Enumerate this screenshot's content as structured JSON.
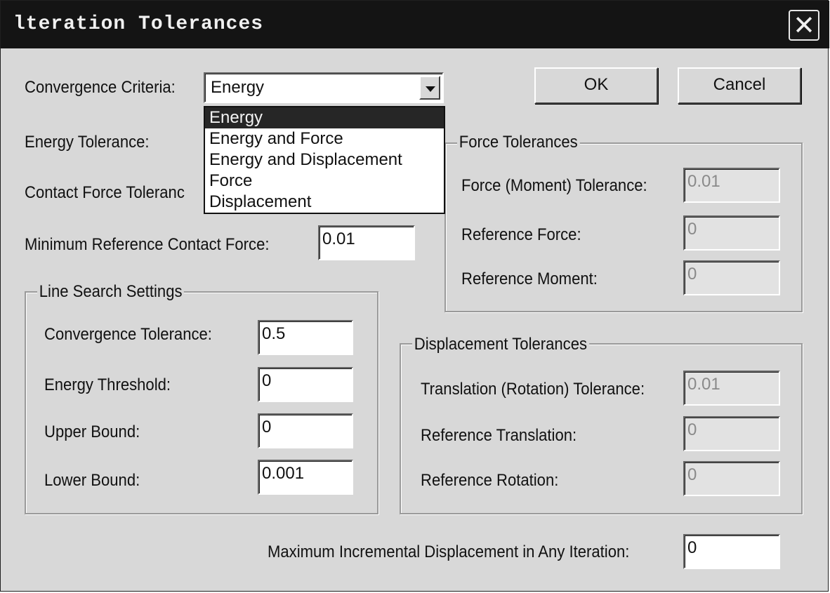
{
  "window": {
    "title": "lteration Tolerances",
    "close_label": "✕"
  },
  "buttons": {
    "ok": "OK",
    "cancel": "Cancel"
  },
  "convergence": {
    "label": "Convergence Criteria:",
    "value": "Energy",
    "options": [
      "Energy",
      "Energy and Force",
      "Energy and Displacement",
      "Force",
      "Displacement"
    ],
    "selected_index": 0
  },
  "energy_tolerance": {
    "label": "Energy Tolerance:"
  },
  "contact_force_tolerance": {
    "label": "Contact Force Toleranc"
  },
  "min_ref_contact_force": {
    "label": "Minimum Reference Contact Force:",
    "value": "0.01"
  },
  "line_search": {
    "title": "Line Search Settings",
    "convergence_tolerance": {
      "label": "Convergence Tolerance:",
      "value": "0.5"
    },
    "energy_threshold": {
      "label": "Energy Threshold:",
      "value": "0"
    },
    "upper_bound": {
      "label": "Upper Bound:",
      "value": "0"
    },
    "lower_bound": {
      "label": "Lower Bound:",
      "value": "0.001"
    }
  },
  "force_tolerances": {
    "title": "Force Tolerances",
    "force_moment_tolerance": {
      "label": "Force (Moment) Tolerance:",
      "value": "0.01"
    },
    "reference_force": {
      "label": "Reference Force:",
      "value": "0"
    },
    "reference_moment": {
      "label": "Reference Moment:",
      "value": "0"
    }
  },
  "displacement_tolerances": {
    "title": "Displacement Tolerances",
    "translation_rotation_tolerance": {
      "label": "Translation (Rotation) Tolerance:",
      "value": "0.01"
    },
    "reference_translation": {
      "label": "Reference Translation:",
      "value": "0"
    },
    "reference_rotation": {
      "label": "Reference Rotation:",
      "value": "0"
    }
  },
  "max_incremental_displacement": {
    "label": "Maximum Incremental Displacement in Any Iteration:",
    "value": "0"
  },
  "colors": {
    "titlebar": "#141414",
    "dialog_bg": "#d8d8d8",
    "selection": "#262626"
  },
  "icons": {
    "close": "close-icon",
    "dropdown_arrow": "chevron-down-icon"
  }
}
